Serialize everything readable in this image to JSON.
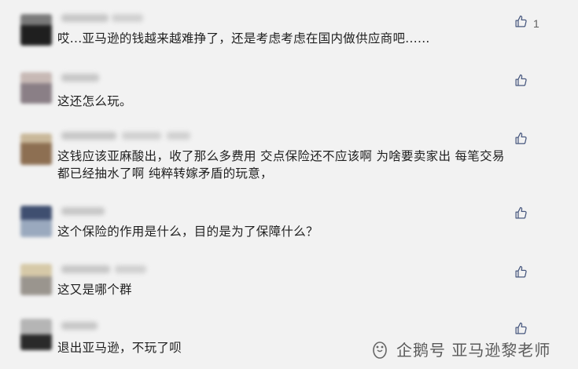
{
  "comments": [
    {
      "text_lines": [
        "哎...亚马逊的钱越来越难挣了，还是考虑考虑在国内做供应商吧......"
      ],
      "likes": "1",
      "avatar_colors": [
        "#6a6a6a",
        "#1f1f1f"
      ]
    },
    {
      "text_lines": [
        "这还怎么玩。"
      ],
      "likes": "",
      "avatar_colors": [
        "#8a7f86",
        "#d5cbc6"
      ]
    },
    {
      "text_lines": [
        "这钱应该亚麻酸出，收了那么多费用 交点保险还不应该啊 为啥要卖家出 每笔交易",
        "都已经抽水了啊 纯粹转嫁矛盾的玩意，"
      ],
      "likes": "",
      "avatar_colors": [
        "#a88e6a",
        "#7a6a5a"
      ]
    },
    {
      "text_lines": [
        "这个保险的作用是什么，目的是为了保障什么？"
      ],
      "likes": "",
      "avatar_colors": [
        "#4a5a75",
        "#8fa0b8"
      ]
    },
    {
      "text_lines": [
        "这又是哪个群"
      ],
      "likes": "",
      "avatar_colors": [
        "#c8b898",
        "#8d8a86"
      ]
    },
    {
      "text_lines": [
        "退出亚马逊，不玩了呗"
      ],
      "likes": "",
      "avatar_colors": [
        "#9a9a9a",
        "#2a2a2a"
      ]
    }
  ],
  "icons": {
    "like": "thumbs-up-icon"
  },
  "watermark": {
    "text": "企鹅号 亚马逊黎老师"
  }
}
